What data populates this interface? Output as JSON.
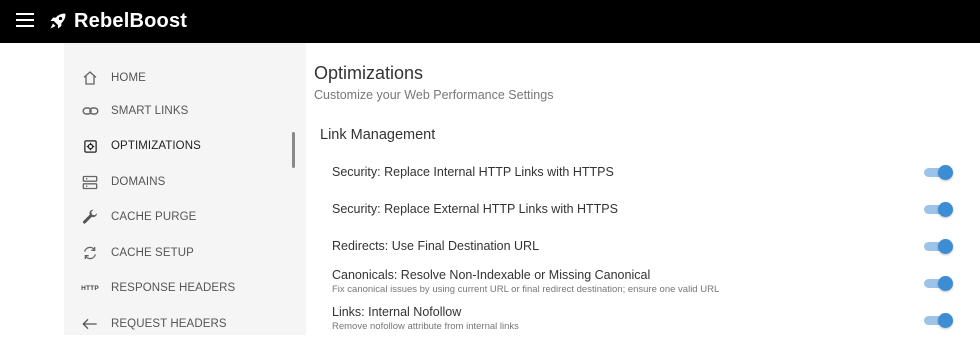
{
  "app": {
    "name": "RebelBoost"
  },
  "sidebar": {
    "items": [
      {
        "label": "HOME",
        "icon": "home-icon"
      },
      {
        "label": "SMART LINKS",
        "icon": "link-icon"
      },
      {
        "label": "OPTIMIZATIONS",
        "icon": "gear-icon",
        "active": true
      },
      {
        "label": "DOMAINS",
        "icon": "server-icon"
      },
      {
        "label": "CACHE PURGE",
        "icon": "wrench-icon"
      },
      {
        "label": "CACHE SETUP",
        "icon": "refresh-icon"
      },
      {
        "label": "RESPONSE HEADERS",
        "icon": "http-icon",
        "icon_text": "HTTP"
      },
      {
        "label": "REQUEST HEADERS",
        "icon": "arrow-left-icon"
      }
    ]
  },
  "main": {
    "title": "Optimizations",
    "subtitle": "Customize your Web Performance Settings",
    "section": "Link Management",
    "settings": [
      {
        "label": "Security: Replace Internal HTTP Links with HTTPS",
        "description": "",
        "enabled": true
      },
      {
        "label": "Security: Replace External HTTP Links with HTTPS",
        "description": "",
        "enabled": true
      },
      {
        "label": "Redirects: Use Final Destination URL",
        "description": "",
        "enabled": true
      },
      {
        "label": "Canonicals: Resolve Non-Indexable or Missing Canonical",
        "description": "Fix canonical issues by using current URL or final redirect destination; ensure one valid URL",
        "enabled": true
      },
      {
        "label": "Links: Internal Nofollow",
        "description": "Remove nofollow attribute from internal links",
        "enabled": true
      }
    ]
  },
  "colors": {
    "topbar": "#000000",
    "toggle_track": "#9dc3e8",
    "toggle_knob": "#3d8dd4",
    "sidebar_bg": "#f5f5f5"
  }
}
